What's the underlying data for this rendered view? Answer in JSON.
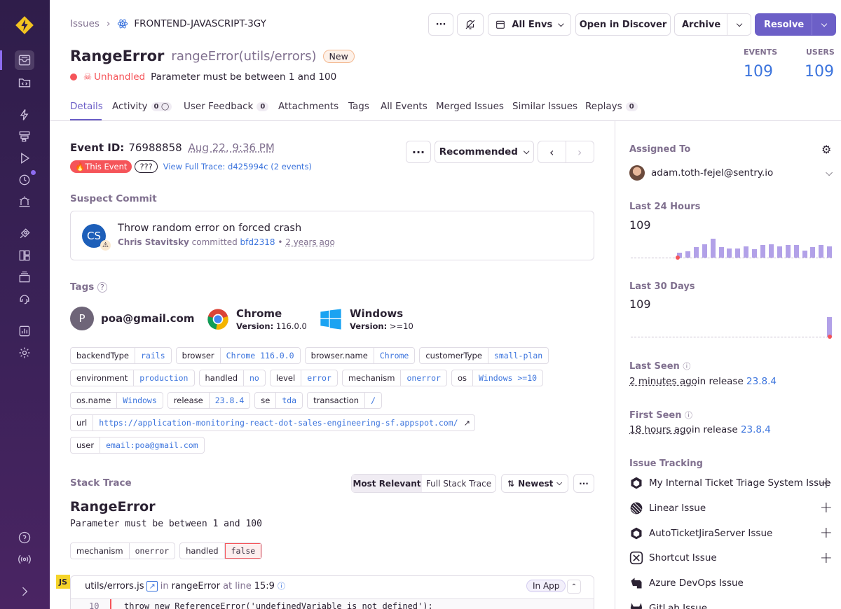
{
  "breadcrumb": {
    "root": "Issues",
    "project": "FRONTEND-JAVASCRIPT-3GY"
  },
  "toolbar": {
    "more": "···",
    "env": "All Envs",
    "discover": "Open in Discover",
    "archive": "Archive",
    "resolve": "Resolve"
  },
  "issue": {
    "type": "RangeError",
    "location": "rangeError(utils/errors)",
    "badge": "New",
    "status": "Unhandled",
    "message": "Parameter must be between 1 and 100"
  },
  "stats": {
    "events_label": "EVENTS",
    "events": "109",
    "users_label": "USERS",
    "users": "109"
  },
  "tabs": [
    {
      "label": "Details",
      "count": ""
    },
    {
      "label": "Activity",
      "count": "0"
    },
    {
      "label": "User Feedback",
      "count": "0"
    },
    {
      "label": "Attachments",
      "count": ""
    },
    {
      "label": "Tags",
      "count": ""
    },
    {
      "label": "All Events",
      "count": ""
    },
    {
      "label": "Merged Issues",
      "count": ""
    },
    {
      "label": "Similar Issues",
      "count": ""
    },
    {
      "label": "Replays",
      "count": "0"
    }
  ],
  "event": {
    "label": "Event ID:",
    "id": "76988858",
    "date": "Aug 22, 9:36 PM",
    "this_event": "This Event",
    "unknown": "???",
    "trace_link": "View Full Trace: d425994c (2 events)",
    "recommended": "Recommended",
    "more": "···"
  },
  "suspect": {
    "title": "Suspect Commit",
    "avatar": "CS",
    "message": "Throw random error on forced crash",
    "author": "Chris Stavitsky",
    "committed": "committed",
    "hash": "bfd2318",
    "dot": "•",
    "ago": "2 years ago"
  },
  "tags": {
    "title": "Tags",
    "user_initial": "P",
    "user": "poa@gmail.com",
    "browser": "Chrome",
    "browser_version_label": "Version:",
    "browser_version": "116.0.0",
    "os": "Windows",
    "os_version_label": "Version:",
    "os_version": ">=10",
    "pills": [
      [
        {
          "k": "backendType",
          "v": "rails"
        },
        {
          "k": "browser",
          "v": "Chrome 116.0.0"
        },
        {
          "k": "browser.name",
          "v": "Chrome"
        },
        {
          "k": "customerType",
          "v": "small-plan"
        }
      ],
      [
        {
          "k": "environment",
          "v": "production"
        },
        {
          "k": "handled",
          "v": "no"
        },
        {
          "k": "level",
          "v": "error"
        },
        {
          "k": "mechanism",
          "v": "onerror"
        },
        {
          "k": "os",
          "v": "Windows >=10"
        }
      ],
      [
        {
          "k": "os.name",
          "v": "Windows"
        },
        {
          "k": "release",
          "v": "23.8.4"
        },
        {
          "k": "se",
          "v": "tda"
        },
        {
          "k": "transaction",
          "v": "/"
        }
      ],
      [
        {
          "k": "url",
          "v": "https://application-monitoring-react-dot-sales-engineering-sf.appspot.com/"
        }
      ],
      [
        {
          "k": "user",
          "v": "email:poa@gmail.com"
        }
      ]
    ]
  },
  "stack": {
    "title": "Stack Trace",
    "most_relevant": "Most Relevant",
    "full": "Full Stack Trace",
    "sort": "Newest",
    "more": "···",
    "error_type": "RangeError",
    "error_msg": "Parameter must be between 1 and 100",
    "pills": [
      {
        "k": "mechanism",
        "v": "onerror"
      },
      {
        "k": "handled",
        "v": "false"
      }
    ],
    "frame": {
      "lang": "JS",
      "file": "utils/errors.js",
      "in": "in",
      "func": "rangeError",
      "at": "at line",
      "line": "15:9",
      "in_app": "In App",
      "code_line_no": "10",
      "code": "throw new ReferenceError('undefinedVariable is not defined');"
    }
  },
  "sidebar": {
    "assigned_title": "Assigned To",
    "assignee": "adam.toth-fejel@sentry.io",
    "last24_title": "Last 24 Hours",
    "last24": "109",
    "last30_title": "Last 30 Days",
    "last30": "109",
    "last_seen_title": "Last Seen",
    "last_seen": "2 minutes ago",
    "in_release": "in release",
    "last_release": "23.8.4",
    "first_seen_title": "First Seen",
    "first_seen": "18 hours ago",
    "first_release": "23.8.4",
    "tracking_title": "Issue Tracking",
    "trackers": [
      {
        "label": "My Internal Ticket Triage System Issue",
        "icon": "cube-icon"
      },
      {
        "label": "Linear Issue",
        "icon": "linear-icon"
      },
      {
        "label": "AutoTicketJiraServer Issue",
        "icon": "cube-icon"
      },
      {
        "label": "Shortcut Issue",
        "icon": "shortcut-icon"
      },
      {
        "label": "Azure DevOps Issue",
        "icon": "azure-icon"
      },
      {
        "label": "GitLab Issue",
        "icon": "gitlab-icon"
      }
    ],
    "bars24": [
      0.25,
      0.3,
      0.5,
      0.65,
      0.9,
      0.5,
      0.45,
      0.45,
      0.55,
      0.4,
      0.6,
      0.65,
      0.55,
      0.6,
      0.6,
      0.35,
      0.5,
      0.6,
      0.55
    ],
    "bar30": 1.0
  },
  "colors": {
    "accent": "#6c5fc7",
    "link": "#3c74dd",
    "error": "#f55459",
    "sidebar": "#3b2258"
  }
}
